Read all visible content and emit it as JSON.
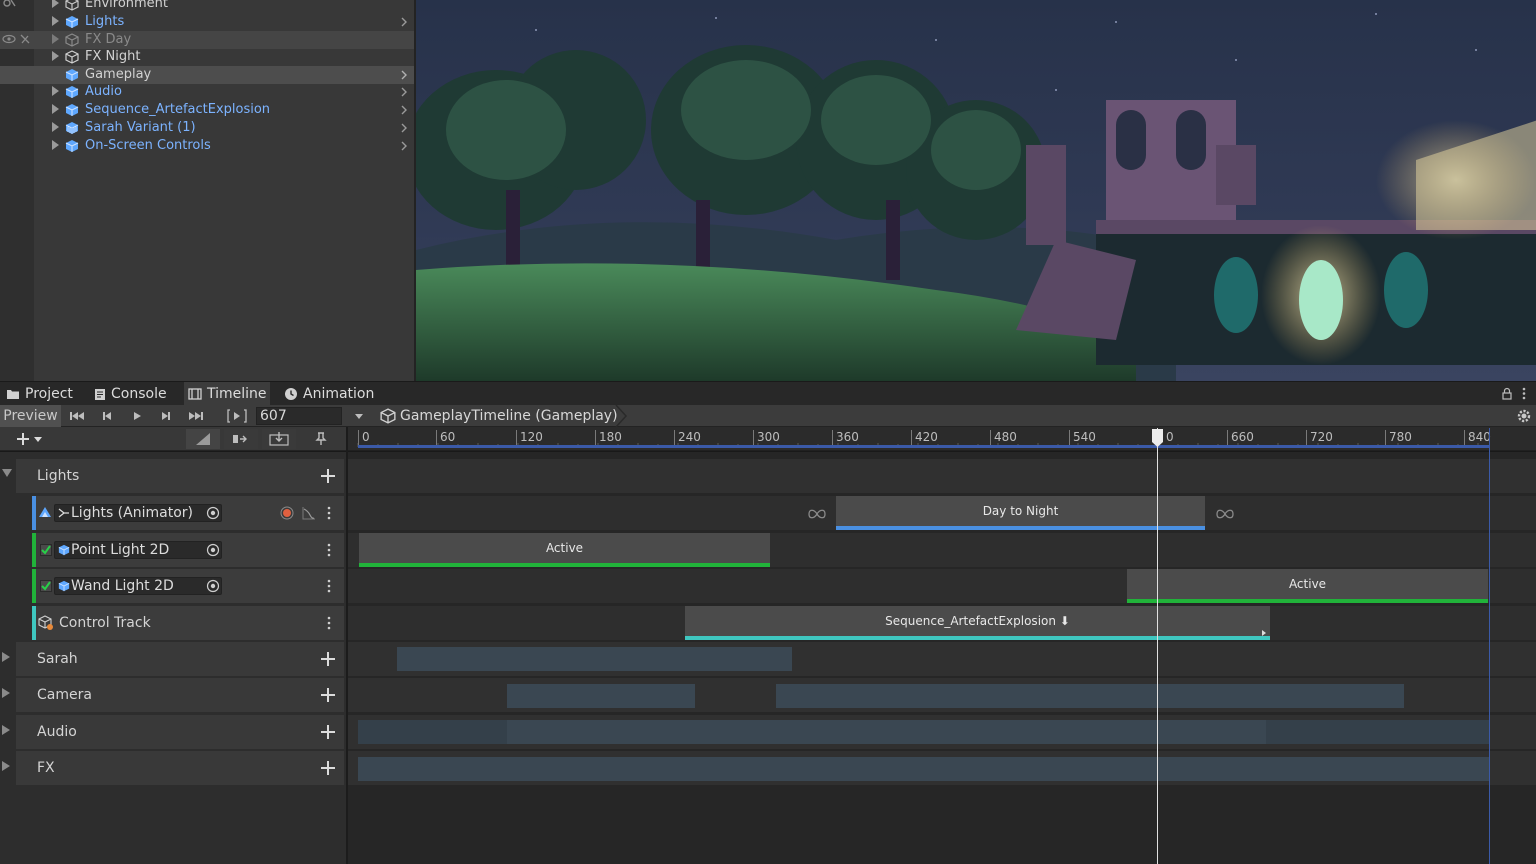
{
  "hierarchy": {
    "items": [
      {
        "label": "Environment",
        "style": "plain",
        "icon": "gameobject-icon"
      },
      {
        "label": "Lights",
        "style": "prefab",
        "icon": "prefab-cube-icon"
      },
      {
        "label": "FX Day",
        "style": "disabled",
        "icon": "gameobject-icon"
      },
      {
        "label": "FX Night",
        "style": "plain",
        "icon": "gameobject-icon"
      },
      {
        "label": "Gameplay",
        "style": "plain",
        "icon": "prefab-cube-icon"
      },
      {
        "label": "Audio",
        "style": "prefab",
        "icon": "prefab-cube-icon"
      },
      {
        "label": "Sequence_ArtefactExplosion",
        "style": "prefab",
        "icon": "prefab-cube-icon"
      },
      {
        "label": "Sarah Variant (1)",
        "style": "prefab",
        "icon": "prefab-variant-icon"
      },
      {
        "label": "On-Screen Controls",
        "style": "prefab",
        "icon": "prefab-cube-icon"
      }
    ]
  },
  "tabs": [
    {
      "label": "Project",
      "icon": "folder-icon"
    },
    {
      "label": "Console",
      "icon": "console-icon"
    },
    {
      "label": "Timeline",
      "icon": "timeline-icon"
    },
    {
      "label": "Animation",
      "icon": "clock-icon"
    }
  ],
  "toolbar": {
    "preview_label": "Preview",
    "frame_value": "607",
    "asset_label": "GameplayTimeline (Gameplay)"
  },
  "ruler": {
    "ticks": [
      "0",
      "60",
      "120",
      "180",
      "240",
      "300",
      "360",
      "420",
      "480",
      "540",
      "0",
      "660",
      "720",
      "780",
      "840"
    ]
  },
  "groups": {
    "lights": "Lights",
    "sarah": "Sarah",
    "camera": "Camera",
    "audio": "Audio",
    "fx": "FX"
  },
  "tracks": {
    "lights_animator": "Lights (Animator)",
    "point_light": "Point Light 2D",
    "wand_light": "Wand Light 2D",
    "control_track": "Control Track"
  },
  "clips": {
    "day_to_night": "Day to Night",
    "active_1": "Active",
    "active_2": "Active",
    "sequence": "Sequence_ArtefactExplosion ⬇"
  },
  "colors": {
    "animation_track": "#4a90e2",
    "activation_track": "#21b33a",
    "control_track": "#3fc7c0",
    "prefab_text": "#7cb3ff"
  }
}
